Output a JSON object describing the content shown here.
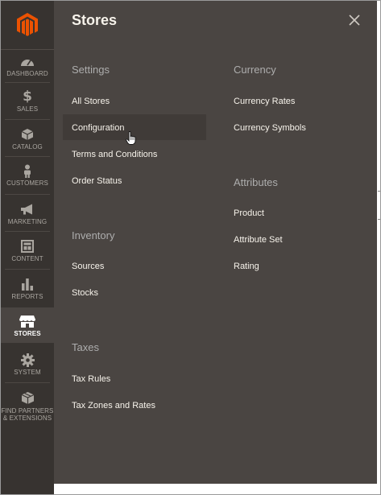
{
  "sidebar": {
    "items": [
      {
        "label": "DASHBOARD",
        "icon": "dashboard-icon"
      },
      {
        "label": "SALES",
        "icon": "dollar-icon"
      },
      {
        "label": "CATALOG",
        "icon": "box-icon"
      },
      {
        "label": "CUSTOMERS",
        "icon": "person-icon"
      },
      {
        "label": "MARKETING",
        "icon": "megaphone-icon"
      },
      {
        "label": "CONTENT",
        "icon": "layout-icon"
      },
      {
        "label": "REPORTS",
        "icon": "bar-chart-icon"
      },
      {
        "label": "STORES",
        "icon": "storefront-icon"
      },
      {
        "label": "SYSTEM",
        "icon": "gear-icon"
      },
      {
        "label_line1": "FIND PARTNERS",
        "label_line2": "& EXTENSIONS",
        "icon": "cube-icon"
      }
    ],
    "active": "STORES"
  },
  "panel": {
    "title": "Stores",
    "close_icon": "close-icon",
    "settings": {
      "title": "Settings",
      "links": [
        "All Stores",
        "Configuration",
        "Terms and Conditions",
        "Order Status"
      ]
    },
    "inventory": {
      "title": "Inventory",
      "links": [
        "Sources",
        "Stocks"
      ]
    },
    "taxes": {
      "title": "Taxes",
      "links": [
        "Tax Rules",
        "Tax Zones and Rates"
      ]
    },
    "currency": {
      "title": "Currency",
      "links": [
        "Currency Rates",
        "Currency Symbols"
      ]
    },
    "attributes": {
      "title": "Attributes",
      "links": [
        "Product",
        "Attribute Set",
        "Rating"
      ]
    },
    "hovered": "Configuration"
  },
  "colors": {
    "sidebar_bg": "#373330",
    "panel_bg": "#4a4542",
    "logo_orange": "#eb5202",
    "text_light": "#f7f3eb",
    "group_title": "#adadad"
  }
}
